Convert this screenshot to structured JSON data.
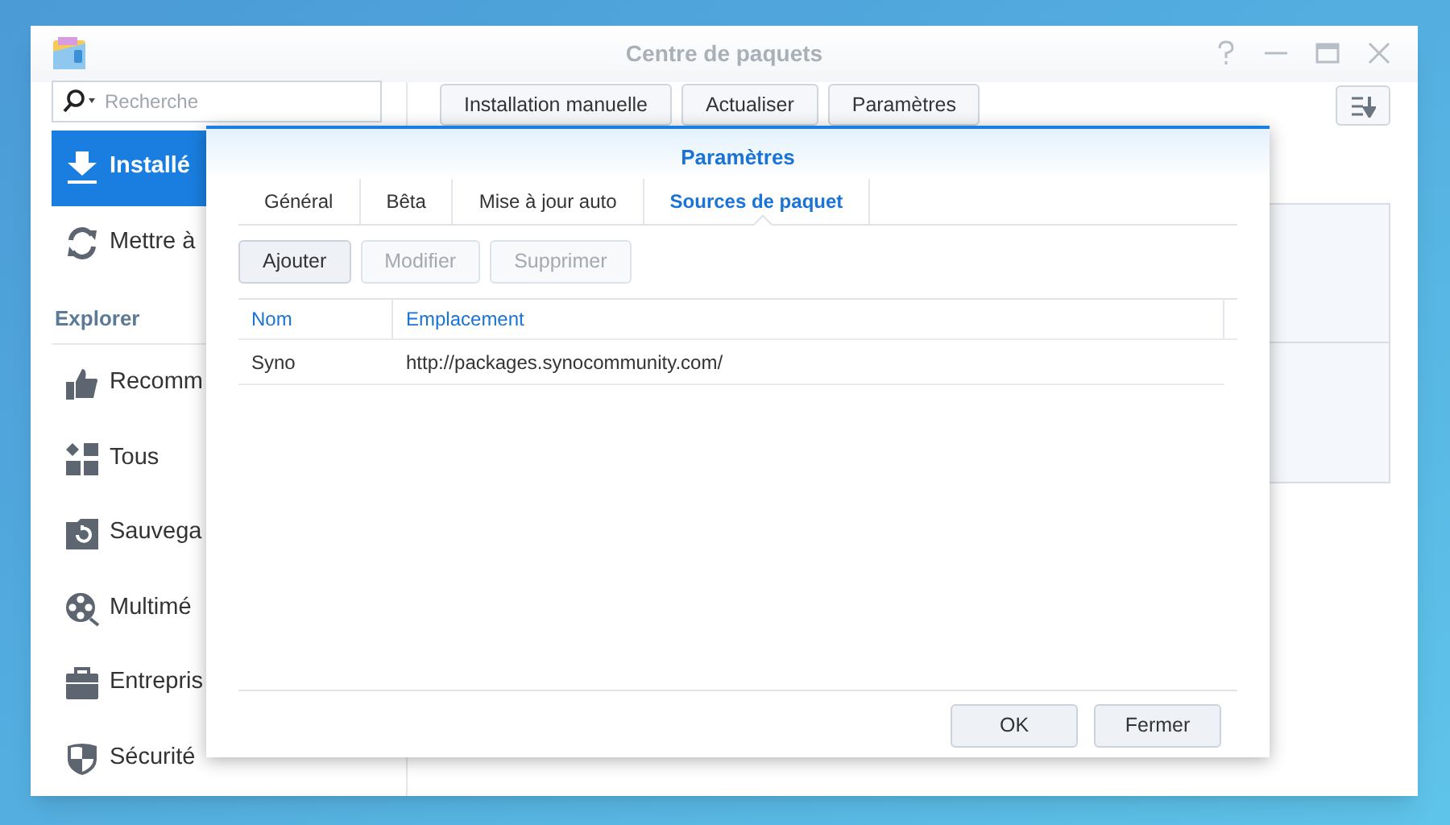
{
  "window": {
    "title": "Centre de paquets"
  },
  "sidebar": {
    "search": {
      "placeholder": "Recherche"
    },
    "sections": [
      {
        "items": [
          {
            "label": "Installé",
            "selected": true
          },
          {
            "label": "Mettre à",
            "selected": false
          }
        ]
      },
      {
        "heading": "Explorer",
        "items": [
          {
            "label": "Recomm",
            "selected": false
          },
          {
            "label": "Tous",
            "selected": false
          },
          {
            "label": "Sauvega",
            "selected": false
          },
          {
            "label": "Multimé",
            "selected": false
          },
          {
            "label": "Entrepris",
            "selected": false
          },
          {
            "label": "Sécurité",
            "selected": false
          }
        ]
      }
    ]
  },
  "toolbar": {
    "buttons": [
      "Installation manuelle",
      "Actualiser",
      "Paramètres"
    ]
  },
  "dialog": {
    "title": "Paramètres",
    "tabs": [
      {
        "label": "Général",
        "selected": false
      },
      {
        "label": "Bêta",
        "selected": false
      },
      {
        "label": "Mise à jour auto",
        "selected": false
      },
      {
        "label": "Sources de paquet",
        "selected": true
      }
    ],
    "actions": [
      {
        "label": "Ajouter",
        "disabled": false
      },
      {
        "label": "Modifier",
        "disabled": true
      },
      {
        "label": "Supprimer",
        "disabled": true
      }
    ],
    "table": {
      "columns": [
        "Nom",
        "Emplacement"
      ],
      "rows": [
        [
          "Syno",
          "http://packages.synocommunity.com/"
        ]
      ]
    },
    "buttons": [
      "OK",
      "Fermer"
    ]
  }
}
